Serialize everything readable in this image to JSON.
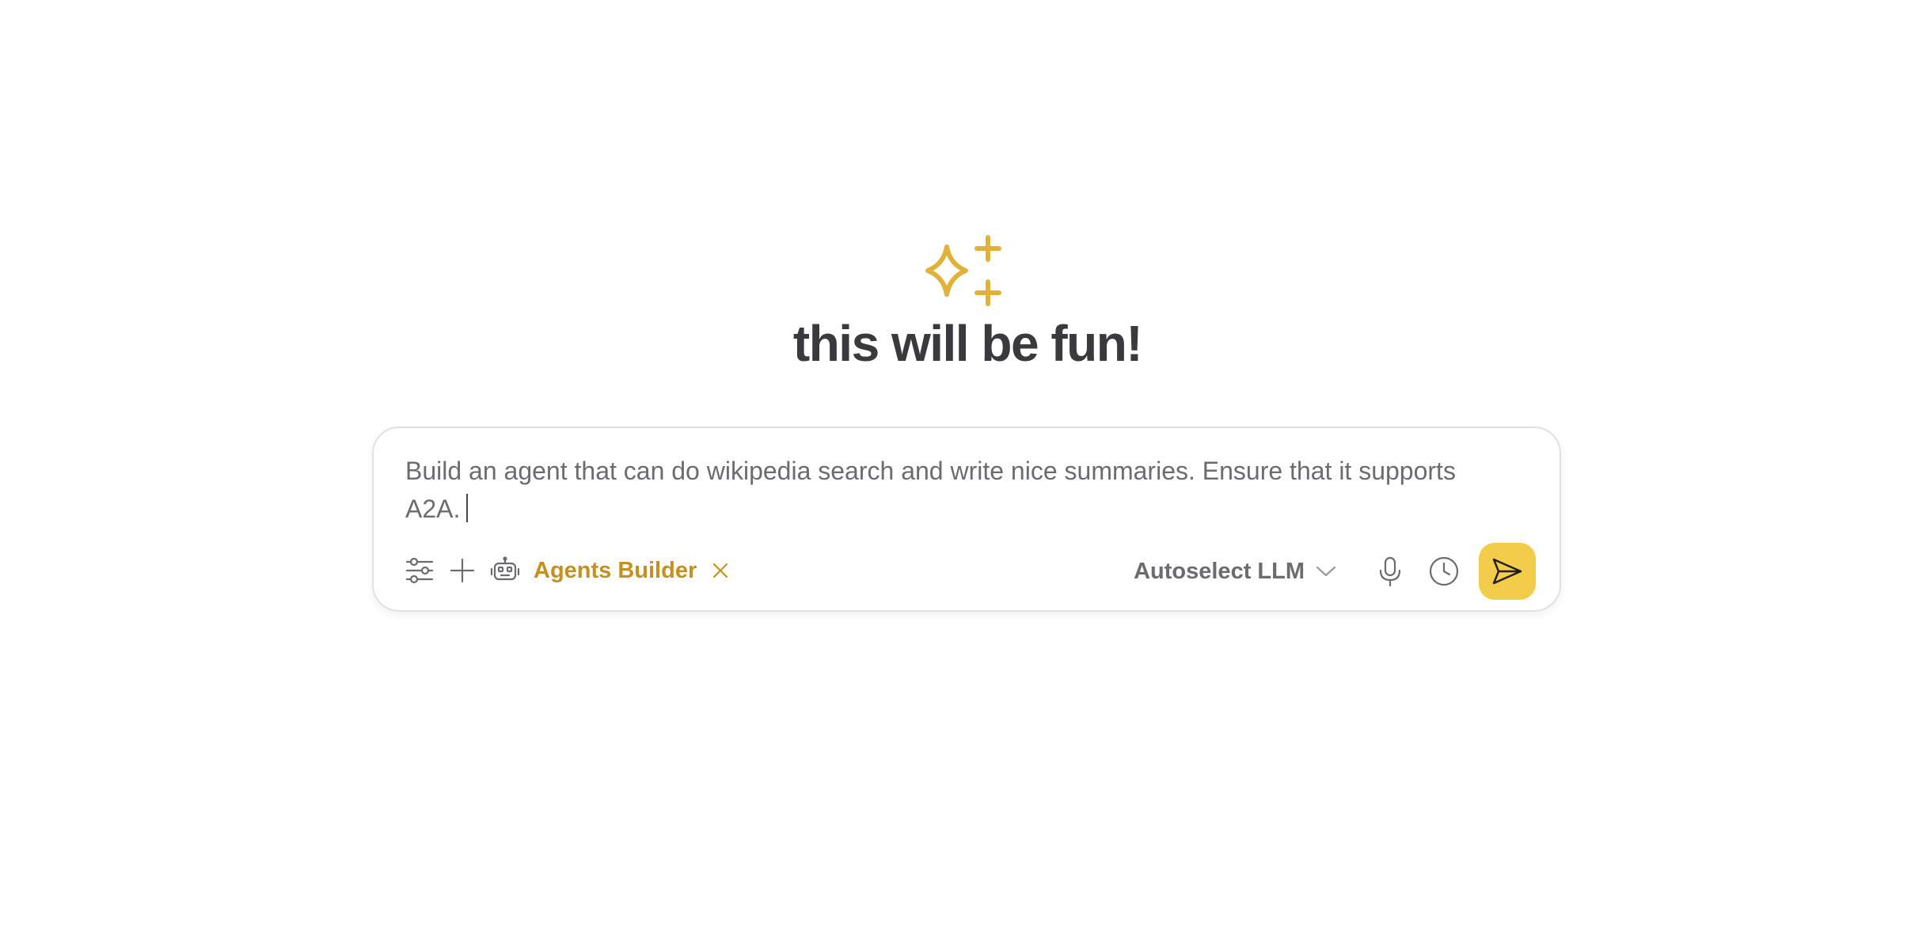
{
  "hero": {
    "icon": "sparkles-icon",
    "title": "this will be fun!"
  },
  "composer": {
    "prompt_text": "Build an agent that can do wikipedia search and write nice summaries. Ensure that it supports A2A.",
    "tools": [
      {
        "icon": "sliders-icon"
      },
      {
        "icon": "plus-icon"
      },
      {
        "icon": "robot-icon"
      }
    ],
    "agent_chip": {
      "label": "Agents Builder",
      "close_icon": "close-icon"
    },
    "model_select": {
      "label": "Autoselect LLM",
      "icon": "chevron-down-icon"
    },
    "actions": {
      "mic_icon": "microphone-icon",
      "history_icon": "clock-icon",
      "send_icon": "send-icon"
    }
  },
  "colors": {
    "accent": "#e0b23a",
    "agent_label": "#c6901e",
    "send_button": "#f3cc4a",
    "title_text": "#3a3a3e",
    "muted_text": "#6b6b72"
  }
}
